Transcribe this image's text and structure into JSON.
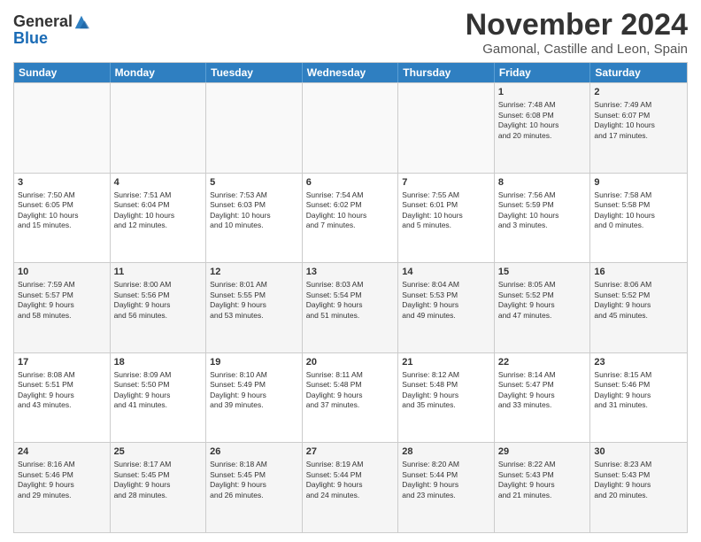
{
  "logo": {
    "general": "General",
    "blue": "Blue"
  },
  "header": {
    "month": "November 2024",
    "location": "Gamonal, Castille and Leon, Spain"
  },
  "days": [
    "Sunday",
    "Monday",
    "Tuesday",
    "Wednesday",
    "Thursday",
    "Friday",
    "Saturday"
  ],
  "rows": [
    [
      {
        "num": "",
        "empty": true,
        "text": ""
      },
      {
        "num": "",
        "empty": true,
        "text": ""
      },
      {
        "num": "",
        "empty": true,
        "text": ""
      },
      {
        "num": "",
        "empty": true,
        "text": ""
      },
      {
        "num": "",
        "empty": true,
        "text": ""
      },
      {
        "num": "1",
        "empty": false,
        "text": "Sunrise: 7:48 AM\nSunset: 6:08 PM\nDaylight: 10 hours\nand 20 minutes."
      },
      {
        "num": "2",
        "empty": false,
        "text": "Sunrise: 7:49 AM\nSunset: 6:07 PM\nDaylight: 10 hours\nand 17 minutes."
      }
    ],
    [
      {
        "num": "3",
        "empty": false,
        "text": "Sunrise: 7:50 AM\nSunset: 6:05 PM\nDaylight: 10 hours\nand 15 minutes."
      },
      {
        "num": "4",
        "empty": false,
        "text": "Sunrise: 7:51 AM\nSunset: 6:04 PM\nDaylight: 10 hours\nand 12 minutes."
      },
      {
        "num": "5",
        "empty": false,
        "text": "Sunrise: 7:53 AM\nSunset: 6:03 PM\nDaylight: 10 hours\nand 10 minutes."
      },
      {
        "num": "6",
        "empty": false,
        "text": "Sunrise: 7:54 AM\nSunset: 6:02 PM\nDaylight: 10 hours\nand 7 minutes."
      },
      {
        "num": "7",
        "empty": false,
        "text": "Sunrise: 7:55 AM\nSunset: 6:01 PM\nDaylight: 10 hours\nand 5 minutes."
      },
      {
        "num": "8",
        "empty": false,
        "text": "Sunrise: 7:56 AM\nSunset: 5:59 PM\nDaylight: 10 hours\nand 3 minutes."
      },
      {
        "num": "9",
        "empty": false,
        "text": "Sunrise: 7:58 AM\nSunset: 5:58 PM\nDaylight: 10 hours\nand 0 minutes."
      }
    ],
    [
      {
        "num": "10",
        "empty": false,
        "text": "Sunrise: 7:59 AM\nSunset: 5:57 PM\nDaylight: 9 hours\nand 58 minutes."
      },
      {
        "num": "11",
        "empty": false,
        "text": "Sunrise: 8:00 AM\nSunset: 5:56 PM\nDaylight: 9 hours\nand 56 minutes."
      },
      {
        "num": "12",
        "empty": false,
        "text": "Sunrise: 8:01 AM\nSunset: 5:55 PM\nDaylight: 9 hours\nand 53 minutes."
      },
      {
        "num": "13",
        "empty": false,
        "text": "Sunrise: 8:03 AM\nSunset: 5:54 PM\nDaylight: 9 hours\nand 51 minutes."
      },
      {
        "num": "14",
        "empty": false,
        "text": "Sunrise: 8:04 AM\nSunset: 5:53 PM\nDaylight: 9 hours\nand 49 minutes."
      },
      {
        "num": "15",
        "empty": false,
        "text": "Sunrise: 8:05 AM\nSunset: 5:52 PM\nDaylight: 9 hours\nand 47 minutes."
      },
      {
        "num": "16",
        "empty": false,
        "text": "Sunrise: 8:06 AM\nSunset: 5:52 PM\nDaylight: 9 hours\nand 45 minutes."
      }
    ],
    [
      {
        "num": "17",
        "empty": false,
        "text": "Sunrise: 8:08 AM\nSunset: 5:51 PM\nDaylight: 9 hours\nand 43 minutes."
      },
      {
        "num": "18",
        "empty": false,
        "text": "Sunrise: 8:09 AM\nSunset: 5:50 PM\nDaylight: 9 hours\nand 41 minutes."
      },
      {
        "num": "19",
        "empty": false,
        "text": "Sunrise: 8:10 AM\nSunset: 5:49 PM\nDaylight: 9 hours\nand 39 minutes."
      },
      {
        "num": "20",
        "empty": false,
        "text": "Sunrise: 8:11 AM\nSunset: 5:48 PM\nDaylight: 9 hours\nand 37 minutes."
      },
      {
        "num": "21",
        "empty": false,
        "text": "Sunrise: 8:12 AM\nSunset: 5:48 PM\nDaylight: 9 hours\nand 35 minutes."
      },
      {
        "num": "22",
        "empty": false,
        "text": "Sunrise: 8:14 AM\nSunset: 5:47 PM\nDaylight: 9 hours\nand 33 minutes."
      },
      {
        "num": "23",
        "empty": false,
        "text": "Sunrise: 8:15 AM\nSunset: 5:46 PM\nDaylight: 9 hours\nand 31 minutes."
      }
    ],
    [
      {
        "num": "24",
        "empty": false,
        "text": "Sunrise: 8:16 AM\nSunset: 5:46 PM\nDaylight: 9 hours\nand 29 minutes."
      },
      {
        "num": "25",
        "empty": false,
        "text": "Sunrise: 8:17 AM\nSunset: 5:45 PM\nDaylight: 9 hours\nand 28 minutes."
      },
      {
        "num": "26",
        "empty": false,
        "text": "Sunrise: 8:18 AM\nSunset: 5:45 PM\nDaylight: 9 hours\nand 26 minutes."
      },
      {
        "num": "27",
        "empty": false,
        "text": "Sunrise: 8:19 AM\nSunset: 5:44 PM\nDaylight: 9 hours\nand 24 minutes."
      },
      {
        "num": "28",
        "empty": false,
        "text": "Sunrise: 8:20 AM\nSunset: 5:44 PM\nDaylight: 9 hours\nand 23 minutes."
      },
      {
        "num": "29",
        "empty": false,
        "text": "Sunrise: 8:22 AM\nSunset: 5:43 PM\nDaylight: 9 hours\nand 21 minutes."
      },
      {
        "num": "30",
        "empty": false,
        "text": "Sunrise: 8:23 AM\nSunset: 5:43 PM\nDaylight: 9 hours\nand 20 minutes."
      }
    ]
  ]
}
